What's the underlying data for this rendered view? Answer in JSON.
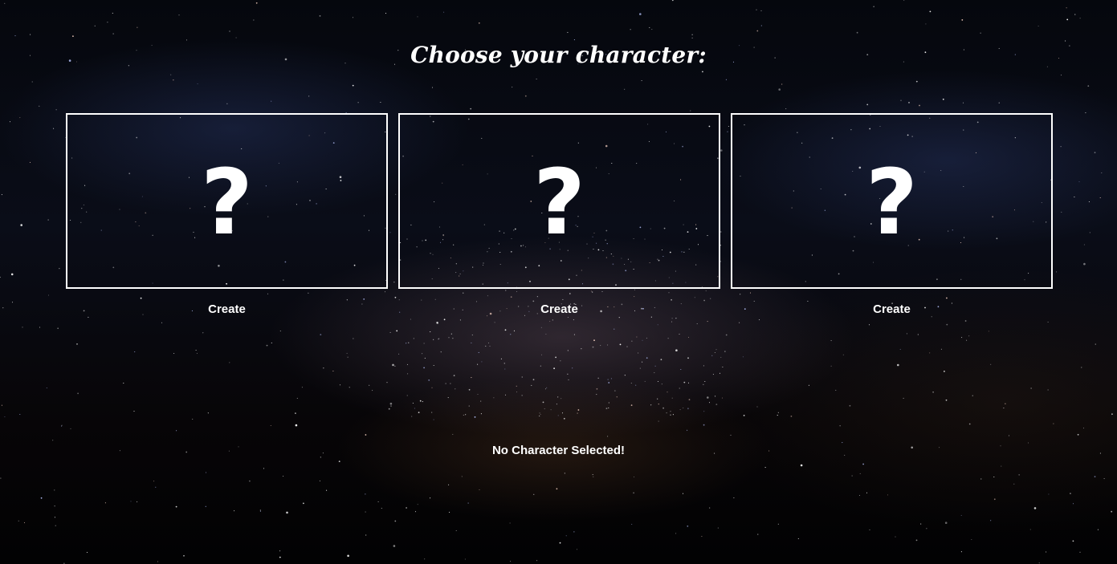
{
  "page": {
    "title": "Choose your character:",
    "status": "No Character Selected!"
  },
  "slots": [
    {
      "symbol": "?",
      "label": "Create"
    },
    {
      "symbol": "?",
      "label": "Create"
    },
    {
      "symbol": "?",
      "label": "Create"
    }
  ],
  "colors": {
    "text": "#ffffff",
    "border": "#ffffff",
    "background": "#05070d"
  },
  "background_image": "starry-night-milky-way"
}
